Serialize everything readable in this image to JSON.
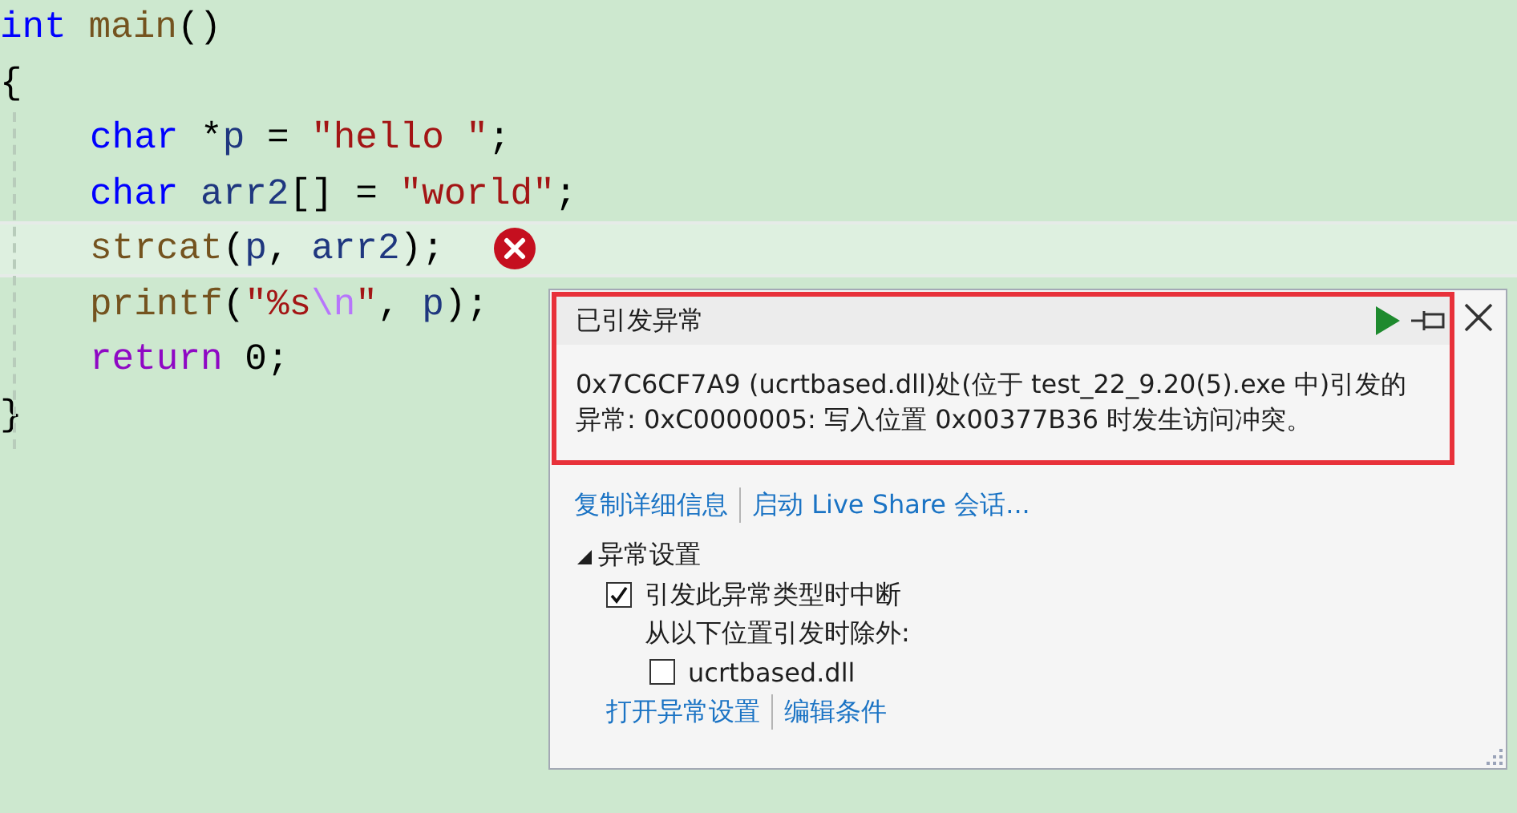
{
  "code": {
    "lines": [
      {
        "current": false,
        "error": false,
        "tokens": [
          {
            "kind": "keyword",
            "text": "int"
          },
          {
            "kind": "func",
            "text": " main"
          },
          {
            "kind": "plain",
            "text": "()"
          }
        ]
      },
      {
        "current": false,
        "error": false,
        "tokens": [
          {
            "kind": "plain",
            "text": "{"
          }
        ],
        "children": [
          {
            "current": false,
            "error": false,
            "tokens": [
              {
                "kind": "keyword",
                "text": "char"
              },
              {
                "kind": "plain",
                "text": " *"
              },
              {
                "kind": "var",
                "text": "p"
              },
              {
                "kind": "plain",
                "text": " = "
              },
              {
                "kind": "string",
                "text": "\"hello \""
              },
              {
                "kind": "plain",
                "text": ";"
              }
            ]
          },
          {
            "current": false,
            "error": false,
            "tokens": [
              {
                "kind": "keyword",
                "text": "char"
              },
              {
                "kind": "var",
                "text": " arr2"
              },
              {
                "kind": "plain",
                "text": "[] = "
              },
              {
                "kind": "string",
                "text": "\"world\""
              },
              {
                "kind": "plain",
                "text": ";"
              }
            ]
          },
          {
            "current": true,
            "error": true,
            "tokens": [
              {
                "kind": "func",
                "text": "strcat"
              },
              {
                "kind": "plain",
                "text": "("
              },
              {
                "kind": "var",
                "text": "p"
              },
              {
                "kind": "plain",
                "text": ", "
              },
              {
                "kind": "var",
                "text": "arr2"
              },
              {
                "kind": "plain",
                "text": ");"
              }
            ]
          },
          {
            "current": false,
            "error": false,
            "tokens": [
              {
                "kind": "func",
                "text": "printf"
              },
              {
                "kind": "plain",
                "text": "("
              },
              {
                "kind": "string",
                "text": "\"%s"
              },
              {
                "kind": "escape",
                "text": "\\n"
              },
              {
                "kind": "string",
                "text": "\""
              },
              {
                "kind": "plain",
                "text": ", "
              },
              {
                "kind": "var",
                "text": "p"
              },
              {
                "kind": "plain",
                "text": ");"
              }
            ]
          },
          {
            "current": false,
            "error": false,
            "tokens": [
              {
                "kind": "control",
                "text": "return"
              },
              {
                "kind": "plain",
                "text": " 0;"
              }
            ]
          }
        ]
      },
      {
        "current": false,
        "error": false,
        "tokens": [
          {
            "kind": "plain",
            "text": "}"
          }
        ]
      }
    ]
  },
  "exception": {
    "title": "已引发异常",
    "message_lines": [
      "0x7C6CF7A9 (ucrtbased.dll)处(位于 test_22_9.20(5).exe 中)引发的",
      "异常: 0xC0000005: 写入位置 0x00377B36 时发生访问冲突。"
    ],
    "links": [
      "复制详细信息",
      "启动 Live Share 会话..."
    ],
    "settings": {
      "label": "异常设置",
      "expanded": true,
      "break_option": {
        "label": "引发此异常类型时中断",
        "checked": true
      },
      "except_label": "从以下位置引发时除外:",
      "exceptions": [
        {
          "label": "ucrtbased.dll",
          "checked": false
        }
      ],
      "links": [
        "打开异常设置",
        "编辑条件"
      ]
    }
  }
}
